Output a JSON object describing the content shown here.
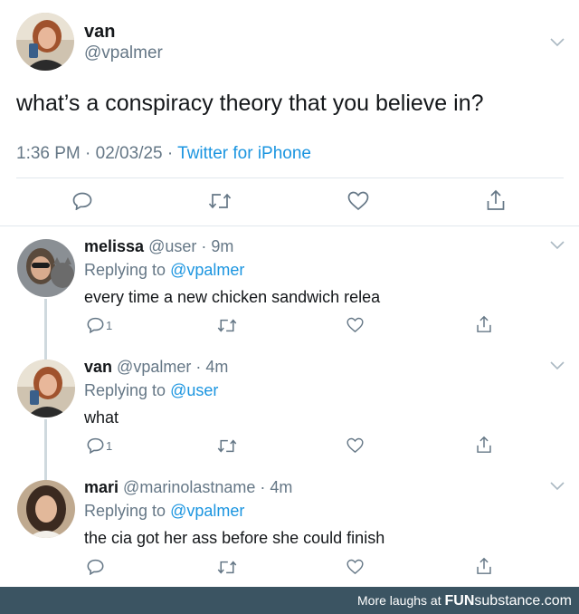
{
  "main_tweet": {
    "name": "van",
    "handle": "@vpalmer",
    "text": "what’s a conspiracy theory that you believe in?",
    "time": "1:36 PM · 02/03/25 ·",
    "source": "Twitter for iPhone"
  },
  "replies": [
    {
      "name": "melissa",
      "meta": "@user · 9m",
      "replying_prefix": "Replying to",
      "replying_to": "@vpalmer",
      "text": "every time a new chicken sandwich relea",
      "reply_count": "1"
    },
    {
      "name": "van",
      "meta": "@vpalmer · 4m",
      "replying_prefix": "Replying to",
      "replying_to": "@user",
      "text": "what",
      "reply_count": "1"
    },
    {
      "name": "mari",
      "meta": "@marinolastname · 4m",
      "replying_prefix": "Replying to",
      "replying_to": "@vpalmer",
      "text": "the cia got her ass before she could finish",
      "reply_count": ""
    }
  ],
  "footer": {
    "prefix": "More laughs at",
    "brand_bold": "FUN",
    "brand_rest": "substance.com"
  },
  "colors": {
    "link": "#1b95e0",
    "muted": "#657786",
    "footer_bg": "#3b5462"
  }
}
